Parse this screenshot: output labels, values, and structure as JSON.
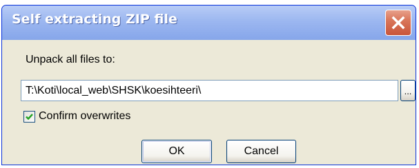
{
  "window": {
    "title": "Self extracting ZIP file",
    "close_icon": "close-icon"
  },
  "form": {
    "unpack_label": "Unpack all files to:",
    "path_value": "T:\\Koti\\local_web\\SHSK\\koesihteeri\\",
    "browse_label": "...",
    "confirm_overwrites": {
      "label": "Confirm overwrites",
      "checked": true
    }
  },
  "buttons": {
    "ok_label": "OK",
    "cancel_label": "Cancel"
  },
  "colors": {
    "title_bar": "#9cb7f0",
    "dialog_bg": "#ece9d8",
    "close_button": "#d9765a",
    "check_mark": "#21a121"
  }
}
